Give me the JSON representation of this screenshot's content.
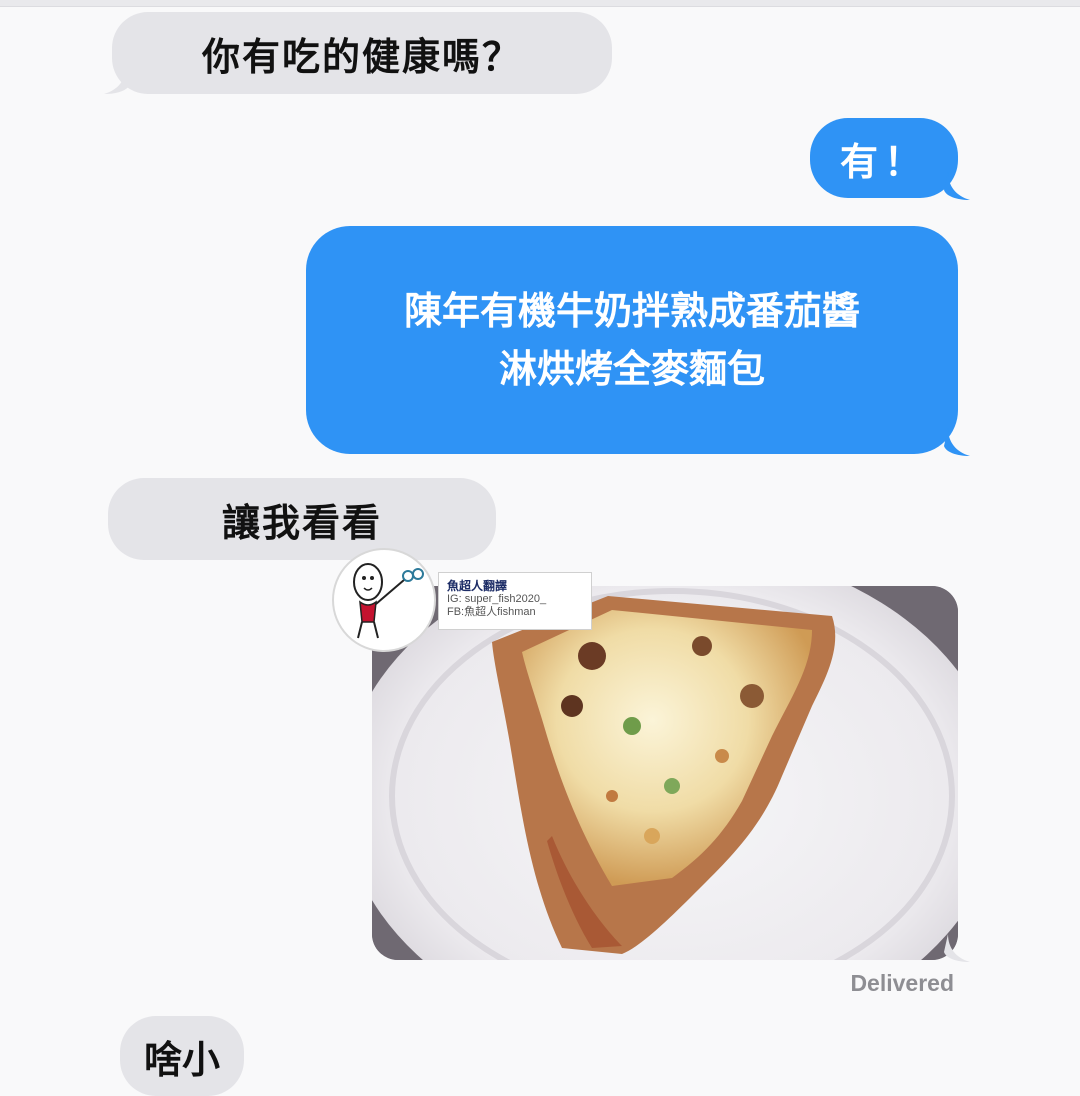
{
  "messages": {
    "m1": "你有吃的健康嗎？",
    "m2": "有！",
    "m3_line1": "陳年有機牛奶拌熟成番茄醬",
    "m3_line2": "淋烘烤全麥麵包",
    "m4": "讓我看看",
    "m5": "啥小"
  },
  "photo_alt": "pizza-slice-photo",
  "delivered": "Delivered",
  "watermark": {
    "title": "魚超人翻譯",
    "ig": "IG: super_fish2020_",
    "fb": "FB:魚超人fishman"
  },
  "colors": {
    "incoming_bubble": "#e4e4e8",
    "outgoing_bubble": "#2f93f5",
    "background": "#f9f9fa",
    "status_text": "#8e8e93"
  }
}
